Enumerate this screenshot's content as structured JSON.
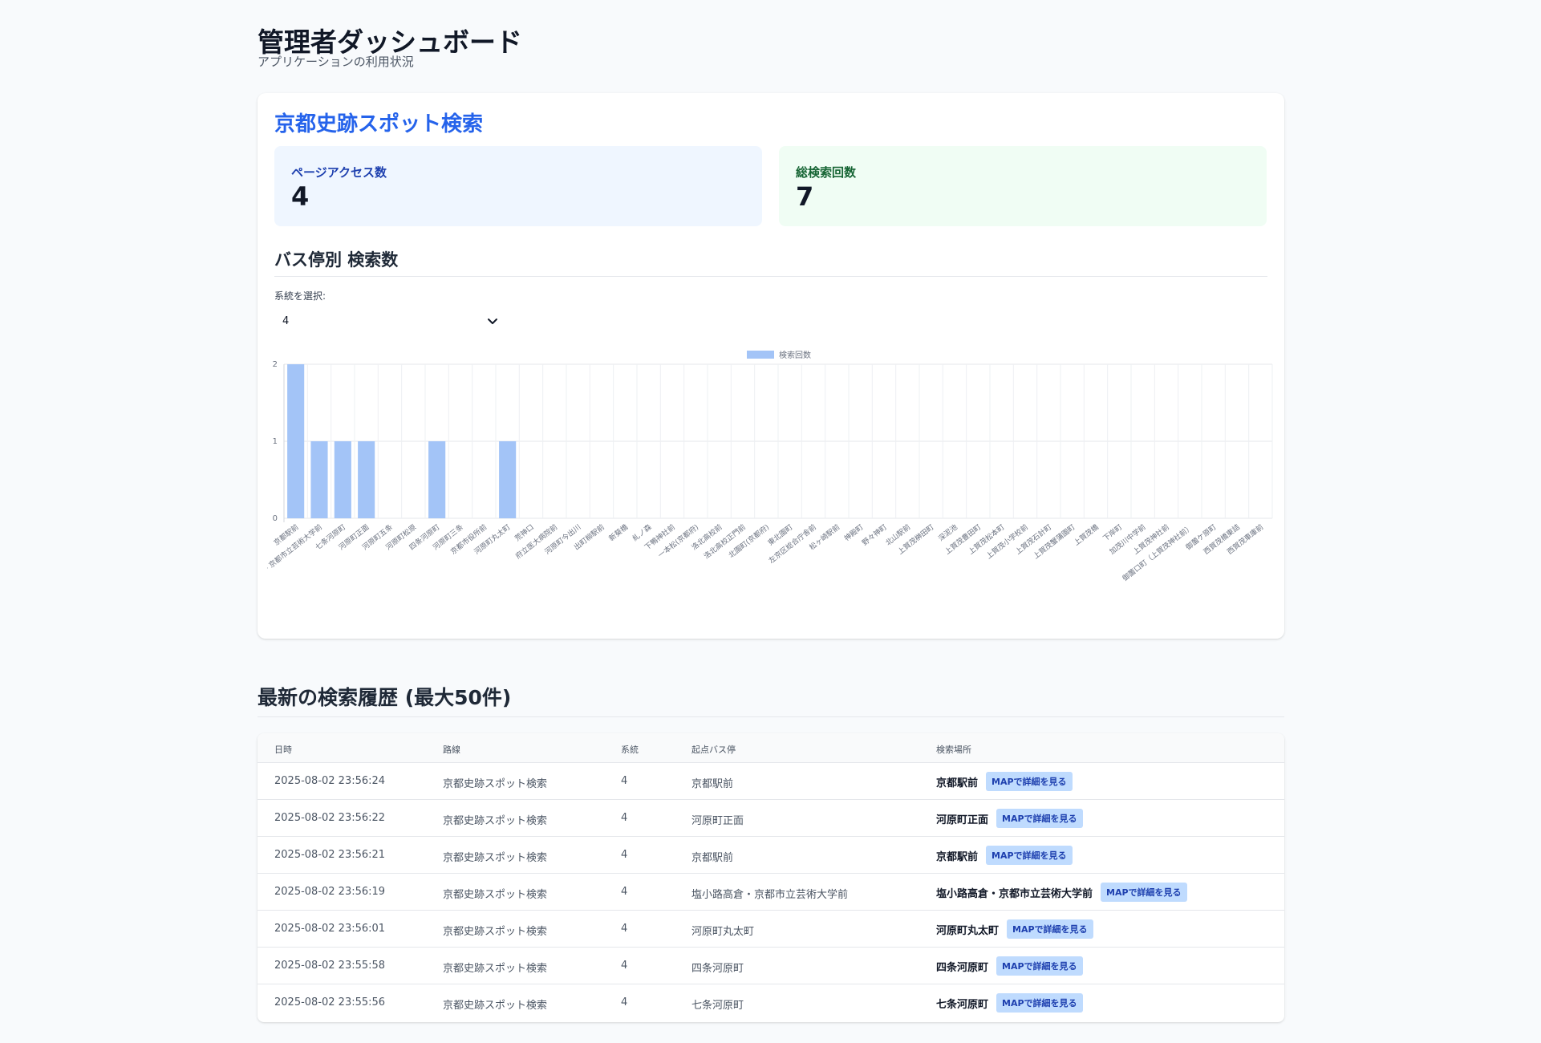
{
  "page": {
    "title": "管理者ダッシュボード",
    "subtitle": "アプリケーションの利用状況"
  },
  "app": {
    "title": "京都史跡スポット検索",
    "stats": {
      "access_label": "ページアクセス数",
      "access_value": "4",
      "search_label": "総検索回数",
      "search_value": "7"
    },
    "section_title": "バス停別 検索数",
    "select_label": "系統を選択:",
    "select_value": "4",
    "colors": {
      "accent": "#2563eb",
      "bar": "#a3c4f7",
      "stat_blue_bg": "#eff6ff",
      "stat_green_bg": "#f0fdf4"
    }
  },
  "chart_data": {
    "type": "bar",
    "categories": [
      "京都駅前",
      "塩小路高倉・京都市立芸術大学前",
      "七条河原町",
      "河原町正面",
      "河原町五条",
      "河原町松原",
      "四条河原町",
      "河原町三条",
      "京都市役所前",
      "河原町丸太町",
      "荒神口",
      "府立医大病院前",
      "河原町今出川",
      "出町柳駅前",
      "新葵橋",
      "糺ノ森",
      "下鴨神社前",
      "一本松(京都府)",
      "洛北高校前",
      "洛北高校正門前",
      "北園町(京都府)",
      "東北園町",
      "左京区総合庁舎前",
      "松ヶ崎駅前",
      "神殿町",
      "野々神町",
      "北山駅前",
      "上賀茂榊田町",
      "深泥池",
      "上賀茂豊田町",
      "上賀茂松本町",
      "上賀茂小学校前",
      "上賀茂石計町",
      "上賀茂蟹蒲園町",
      "上賀茂橋",
      "下岸町",
      "加茂川中学前",
      "上賀茂神社前",
      "御薗口町（上賀茂神社前）",
      "御薗ケ原町",
      "西賀茂橋東詰",
      "西賀茂車庫前"
    ],
    "series": [
      {
        "name": "検索回数",
        "values": [
          2,
          1,
          1,
          1,
          0,
          0,
          1,
          0,
          0,
          1,
          0,
          0,
          0,
          0,
          0,
          0,
          0,
          0,
          0,
          0,
          0,
          0,
          0,
          0,
          0,
          0,
          0,
          0,
          0,
          0,
          0,
          0,
          0,
          0,
          0,
          0,
          0,
          0,
          0,
          0,
          0,
          0
        ]
      }
    ],
    "yticks": [
      "0",
      "1",
      "2"
    ],
    "ylim": [
      0,
      2
    ],
    "grid": true,
    "legend": "top-center"
  },
  "history": {
    "title": "最新の検索履歴 (最大50件)",
    "headers": {
      "date": "日時",
      "route": "路線",
      "system": "系統",
      "start": "起点バス停",
      "place": "検索場所"
    },
    "rows": [
      {
        "date": "2025-08-02 23:56:24",
        "route": "京都史跡スポット検索",
        "system": "4",
        "start": "京都駅前",
        "place": "京都駅前",
        "button": "MAPで詳細を見る"
      },
      {
        "date": "2025-08-02 23:56:22",
        "route": "京都史跡スポット検索",
        "system": "4",
        "start": "河原町正面",
        "place": "河原町正面",
        "button": "MAPで詳細を見る"
      },
      {
        "date": "2025-08-02 23:56:21",
        "route": "京都史跡スポット検索",
        "system": "4",
        "start": "京都駅前",
        "place": "京都駅前",
        "button": "MAPで詳細を見る"
      },
      {
        "date": "2025-08-02 23:56:19",
        "route": "京都史跡スポット検索",
        "system": "4",
        "start": "塩小路高倉・京都市立芸術大学前",
        "place": "塩小路高倉・京都市立芸術大学前",
        "button": "MAPで詳細を見る"
      },
      {
        "date": "2025-08-02 23:56:01",
        "route": "京都史跡スポット検索",
        "system": "4",
        "start": "河原町丸太町",
        "place": "河原町丸太町",
        "button": "MAPで詳細を見る"
      },
      {
        "date": "2025-08-02 23:55:58",
        "route": "京都史跡スポット検索",
        "system": "4",
        "start": "四条河原町",
        "place": "四条河原町",
        "button": "MAPで詳細を見る"
      },
      {
        "date": "2025-08-02 23:55:56",
        "route": "京都史跡スポット検索",
        "system": "4",
        "start": "七条河原町",
        "place": "七条河原町",
        "button": "MAPで詳細を見る"
      }
    ]
  }
}
